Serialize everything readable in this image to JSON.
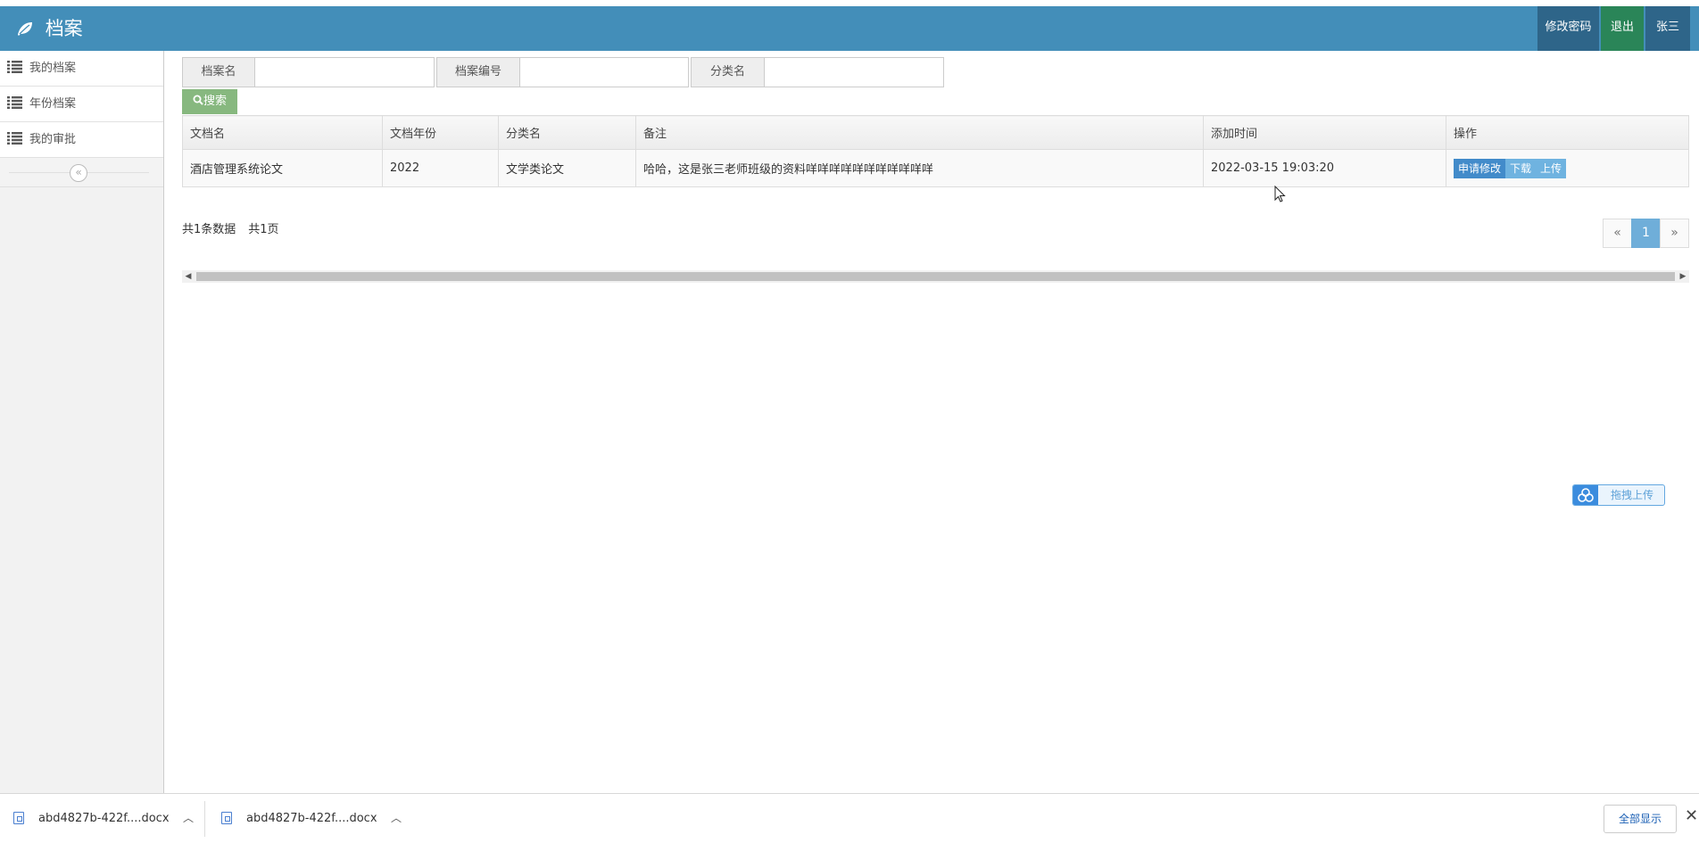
{
  "navbar": {
    "brand": "档案",
    "change_password": "修改密码",
    "logout": "退出",
    "user": "张三"
  },
  "sidebar": {
    "items": [
      {
        "label": "我的档案"
      },
      {
        "label": "年份档案"
      },
      {
        "label": "我的审批"
      }
    ],
    "collapse_icon": "double-chevron-left-icon"
  },
  "search": {
    "fields": [
      {
        "label": "档案名",
        "value": ""
      },
      {
        "label": "档案编号",
        "value": ""
      },
      {
        "label": "分类名",
        "value": ""
      }
    ],
    "button": "搜索"
  },
  "table": {
    "headers": [
      "文档名",
      "文档年份",
      "分类名",
      "备注",
      "添加时间",
      "操作"
    ],
    "rows": [
      {
        "name": "酒店管理系统论文",
        "year": "2022",
        "category": "文学类论文",
        "remark": "哈哈，这是张三老师班级的资料咩咩咩咩咩咩咩咩咩咩咩",
        "added": "2022-03-15 19:03:20",
        "actions": [
          "申请修改",
          "下载",
          "上传"
        ]
      }
    ]
  },
  "summary": {
    "total_records": "共1条数据",
    "total_pages": "共1页"
  },
  "pagination": {
    "prev": "«",
    "current": "1",
    "next": "»"
  },
  "drag_upload": {
    "label": "拖拽上传"
  },
  "download_bar": {
    "files": [
      {
        "name": "abd4827b-422f....docx"
      },
      {
        "name": "abd4827b-422f....docx"
      }
    ],
    "show_all": "全部显示",
    "close": "✕"
  },
  "colors": {
    "navbar": "#438eb9",
    "logout": "#2a8558",
    "search_button": "#87b87f",
    "primary": "#428bca",
    "info": "#6fb3e0"
  }
}
